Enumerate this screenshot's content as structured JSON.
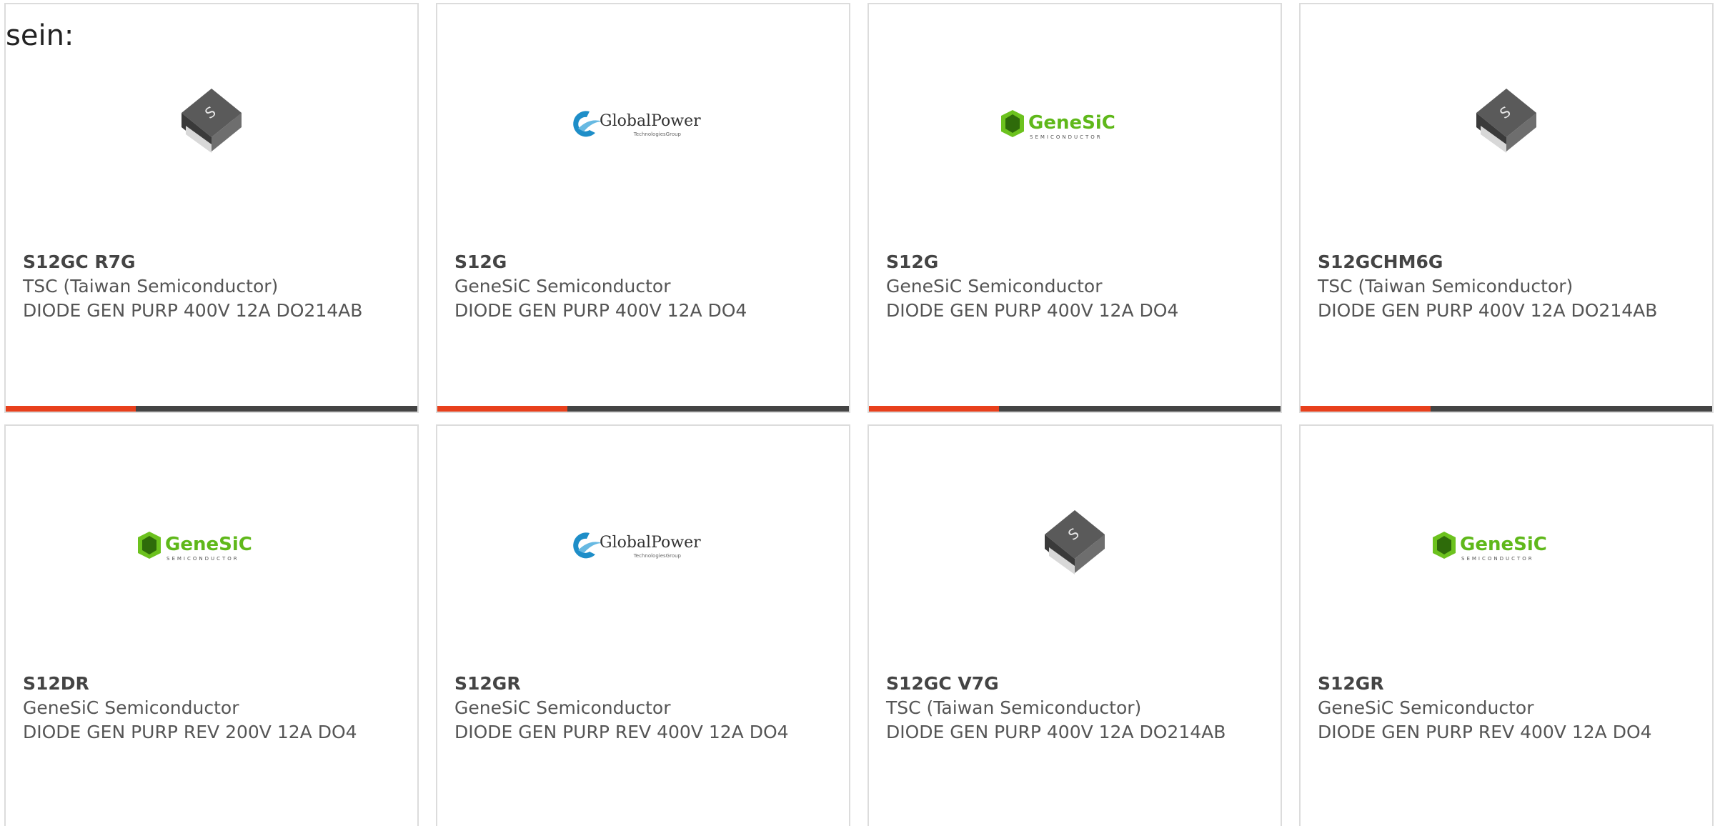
{
  "intro_text": "sein:",
  "colors": {
    "accent": "#e8401c",
    "bar": "#444444",
    "border": "#dcdcdc",
    "text": "#555555"
  },
  "products": [
    {
      "part": "S12GC R7G",
      "maker": "TSC (Taiwan Semiconductor)",
      "desc": "DIODE GEN PURP 400V 12A DO214AB",
      "image": "smd-diode-package-icon"
    },
    {
      "part": "S12G",
      "maker": "GeneSiC Semiconductor",
      "desc": "DIODE GEN PURP 400V 12A DO4",
      "image": "globalpower-logo"
    },
    {
      "part": "S12G",
      "maker": "GeneSiC Semiconductor",
      "desc": "DIODE GEN PURP 400V 12A DO4",
      "image": "genesic-logo"
    },
    {
      "part": "S12GCHM6G",
      "maker": "TSC (Taiwan Semiconductor)",
      "desc": "DIODE GEN PURP 400V 12A DO214AB",
      "image": "smd-diode-package-icon"
    },
    {
      "part": "S12DR",
      "maker": "GeneSiC Semiconductor",
      "desc": "DIODE GEN PURP REV 200V 12A DO4",
      "image": "genesic-logo"
    },
    {
      "part": "S12GR",
      "maker": "GeneSiC Semiconductor",
      "desc": "DIODE GEN PURP REV 400V 12A DO4",
      "image": "globalpower-logo"
    },
    {
      "part": "S12GC V7G",
      "maker": "TSC (Taiwan Semiconductor)",
      "desc": "DIODE GEN PURP 400V 12A DO214AB",
      "image": "smd-diode-package-icon"
    },
    {
      "part": "S12GR",
      "maker": "GeneSiC Semiconductor",
      "desc": "DIODE GEN PURP REV 400V 12A DO4",
      "image": "genesic-logo"
    }
  ],
  "logos": {
    "globalpower": {
      "name": "GlobalPower",
      "sub": "TechnologiesGroup"
    },
    "genesic": {
      "name": "GeneSiC",
      "sub": "SEMICONDUCTOR"
    }
  }
}
